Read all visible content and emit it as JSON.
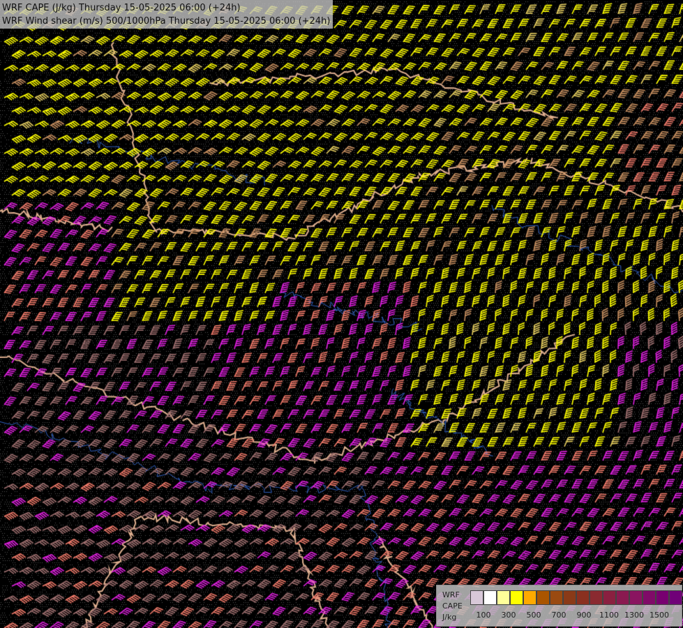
{
  "title": {
    "line1": "WRF CAPE (J/kg) Thursday 15-05-2025 06:00 (+24h)",
    "line2": "WRF Wind shear (m/s) 500/1000hPa Thursday 15-05-2025 06:00 (+24h)"
  },
  "legend": {
    "label_model": "WRF",
    "label_field": "CAPE",
    "label_unit": "J/kg",
    "swatch_colors": [
      "#d8c8d8",
      "#ffffff",
      "#ffff99",
      "#ffff00",
      "#ffaa00",
      "#aa5500",
      "#9a4a10",
      "#8a3a18",
      "#8a3020",
      "#8a2a30",
      "#8a2040",
      "#8a1a50",
      "#8a1460",
      "#800a68",
      "#780070",
      "#700078"
    ],
    "tick_labels": [
      "100",
      "300",
      "500",
      "700",
      "900",
      "1100",
      "1300",
      "1500"
    ]
  },
  "map": {
    "barb_colors": {
      "low_cape": "#ffff00",
      "low_mid": "#e8d060",
      "mid": "#c89060",
      "high_salmon": "#f07a6a",
      "very_high": "#e020e0",
      "dim": "#a07070"
    },
    "background_color": "#000000",
    "border_color": "#e0b090",
    "river_color": "#3060c0"
  }
}
